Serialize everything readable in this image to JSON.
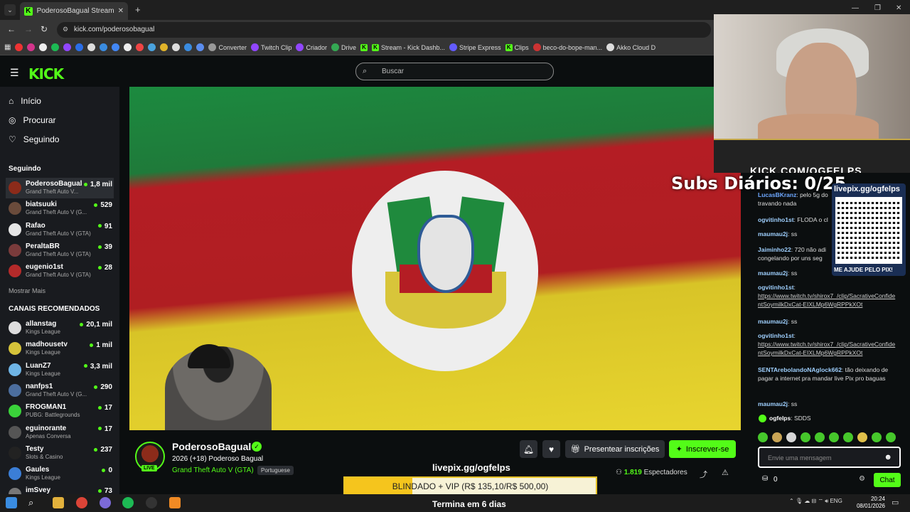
{
  "browser": {
    "tab_title": "PoderosoBagual Stream - Watc",
    "url": "kick.com/poderosobagual",
    "bookmarks": [
      "Converter",
      "Twitch Clip",
      "Criador",
      "Drive",
      "Stream - Kick Dashb...",
      "Stripe Express",
      "Clips",
      "beco-do-bope-man...",
      "Akko Cloud D"
    ]
  },
  "header": {
    "logo": "KICK",
    "search_placeholder": "Buscar"
  },
  "sidebar": {
    "nav": [
      {
        "label": "Início",
        "icon": "home-icon"
      },
      {
        "label": "Procurar",
        "icon": "compass-icon"
      },
      {
        "label": "Seguindo",
        "icon": "heart-icon"
      }
    ],
    "following_label": "Seguindo",
    "following": [
      {
        "name": "PoderosoBagual",
        "game": "Grand Theft Auto V...",
        "viewers": "1,8 mil",
        "color": "#8c2b1a"
      },
      {
        "name": "biatsuuki",
        "game": "Grand Theft Auto V (G...",
        "viewers": "529",
        "color": "#6a4b3b"
      },
      {
        "name": "Rafao",
        "game": "Grand Theft Auto V (GTA)",
        "viewers": "91",
        "color": "#e5e5e5"
      },
      {
        "name": "PeraltaBR",
        "game": "Grand Theft Auto V (GTA)",
        "viewers": "39",
        "color": "#7a3b3b"
      },
      {
        "name": "eugenio1st",
        "game": "Grand Theft Auto V (GTA)",
        "viewers": "28",
        "color": "#b42a2a"
      }
    ],
    "show_more_1": "Mostrar Mais",
    "recommended_label": "CANAIS RECOMENDADOS",
    "recommended": [
      {
        "name": "allanstag",
        "game": "Kings League",
        "viewers": "20,1 mil",
        "color": "#dddddd"
      },
      {
        "name": "madhousetv",
        "game": "Kings League",
        "viewers": "1 mil",
        "color": "#d6c33a"
      },
      {
        "name": "LuanZ7",
        "game": "Kings League",
        "viewers": "3,3 mil",
        "color": "#6fb5e6"
      },
      {
        "name": "nanfps1",
        "game": "Grand Theft Auto V (G...",
        "viewers": "290",
        "color": "#4c6e9e"
      },
      {
        "name": "FROGMAN1",
        "game": "PUBG: Battlegrounds",
        "viewers": "17",
        "color": "#3ad23a"
      },
      {
        "name": "eguinorante",
        "game": "Apenas Conversa",
        "viewers": "17",
        "color": "#555555"
      },
      {
        "name": "Testy",
        "game": "Slots & Casino",
        "viewers": "237",
        "color": "#222222"
      },
      {
        "name": "Gaules",
        "game": "Kings League",
        "viewers": "0",
        "color": "#3b7ed6"
      },
      {
        "name": "imSvey",
        "game": "",
        "viewers": "73",
        "color": "#777777"
      }
    ]
  },
  "overlay": {
    "subs_diarios": "Subs Diários: 0/25",
    "kick_banner": "KICK.COM/OGFELPS"
  },
  "chat": {
    "qr_title": "livepix.gg/ogfelps",
    "qr_help": "ME AJUDE PELO PIX!",
    "messages": [
      {
        "user": "LucasBKranz",
        "color": "#6ea8ff",
        "text": "pelo 5g do",
        "extra": "travando nada"
      },
      {
        "user": "ogvitinho1st",
        "color": "#9fd0ff",
        "text": "FLODA o cl"
      },
      {
        "user": "maumau2j",
        "color": "#9fd0ff",
        "text": "ss"
      },
      {
        "user": "Jaiminho22",
        "color": "#9fd0ff",
        "text": "720 não adi",
        "extra": "congelando por uns seg"
      },
      {
        "user": "maumau2j",
        "color": "#9fd0ff",
        "text": "ss"
      },
      {
        "user": "ogvitinho1st",
        "color": "#9fd0ff",
        "text": "",
        "link": "https://www.twitch.tv/shirox7_/clip/SacrativeConfidentSoymilkDxCat-EIXLMp6WgRPPkXOt"
      },
      {
        "user": "maumau2j",
        "color": "#9fd0ff",
        "text": "ss"
      },
      {
        "user": "ogvitinho1st",
        "color": "#9fd0ff",
        "text": "",
        "link": "https://www.twitch.tv/shirox7_/clip/SacrativeConfidentSoymilkDxCat-EIXLMp6WgRPPkXOt"
      },
      {
        "user": "SENTArebolandoNAglock662",
        "color": "#9fd0ff",
        "text": "tão deixando de pagar a internet pra mandar live Pix pro baguas"
      },
      {
        "user": "maumau2j",
        "color": "#9fd0ff",
        "text": "ss"
      },
      {
        "user": "ogfelps",
        "color": "#ffffff",
        "text": "SDDS"
      }
    ],
    "input_placeholder": "Envie uma mensagem",
    "points": "0",
    "send_label": "Chat"
  },
  "stream": {
    "name": "PoderosoBagual",
    "title": "2026 (+18) Poderoso Bagual",
    "game": "Grand Theft Auto V (GTA)",
    "language": "Portuguese",
    "live": "LIVE",
    "gift_label": "Presentear inscrições",
    "subscribe_label": "Inscrever-se",
    "viewers_count": "1.819",
    "viewers_label": "Espectadores"
  },
  "livepix": {
    "url": "livepix.gg/ogfelps",
    "goal_text": "BLINDADO + VIP (R$ 135,10/R$ 500,00)",
    "goal_fraction": 0.27,
    "ends_text": "Termina em 6 dias"
  },
  "taskbar": {
    "lang": "ENG",
    "time": "20:24",
    "date": "08/01/2026"
  }
}
